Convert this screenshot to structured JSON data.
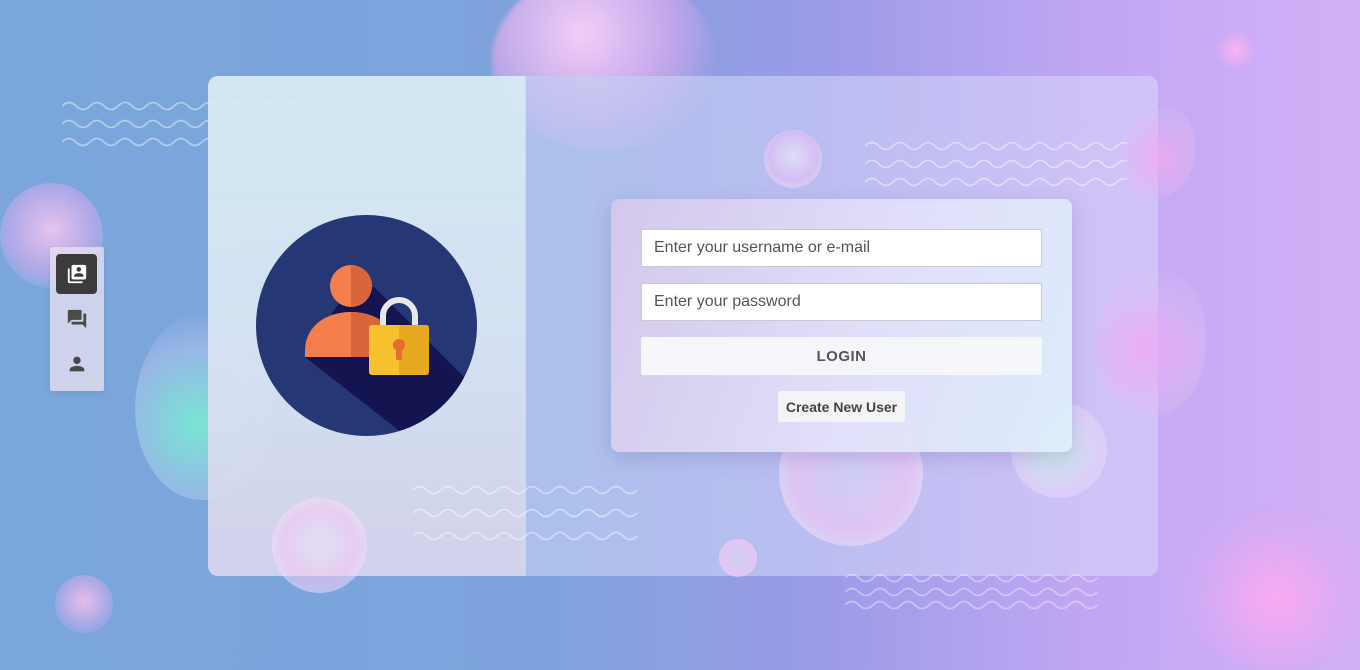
{
  "sidebar": {
    "items": [
      {
        "icon": "contacts-icon",
        "active": true
      },
      {
        "icon": "chat-icon",
        "active": false
      },
      {
        "icon": "user-icon",
        "active": false
      }
    ]
  },
  "login": {
    "username_placeholder": "Enter your username or e-mail",
    "password_placeholder": "Enter your password",
    "login_label": "LOGIN",
    "create_label": "Create New User"
  },
  "illustration": {
    "icon": "user-lock-icon"
  },
  "colors": {
    "sidebar_active": "#3b3b3b",
    "logo_circle": "#263776",
    "logo_person": "#f47f4c",
    "logo_lock": "#f7c12d"
  }
}
